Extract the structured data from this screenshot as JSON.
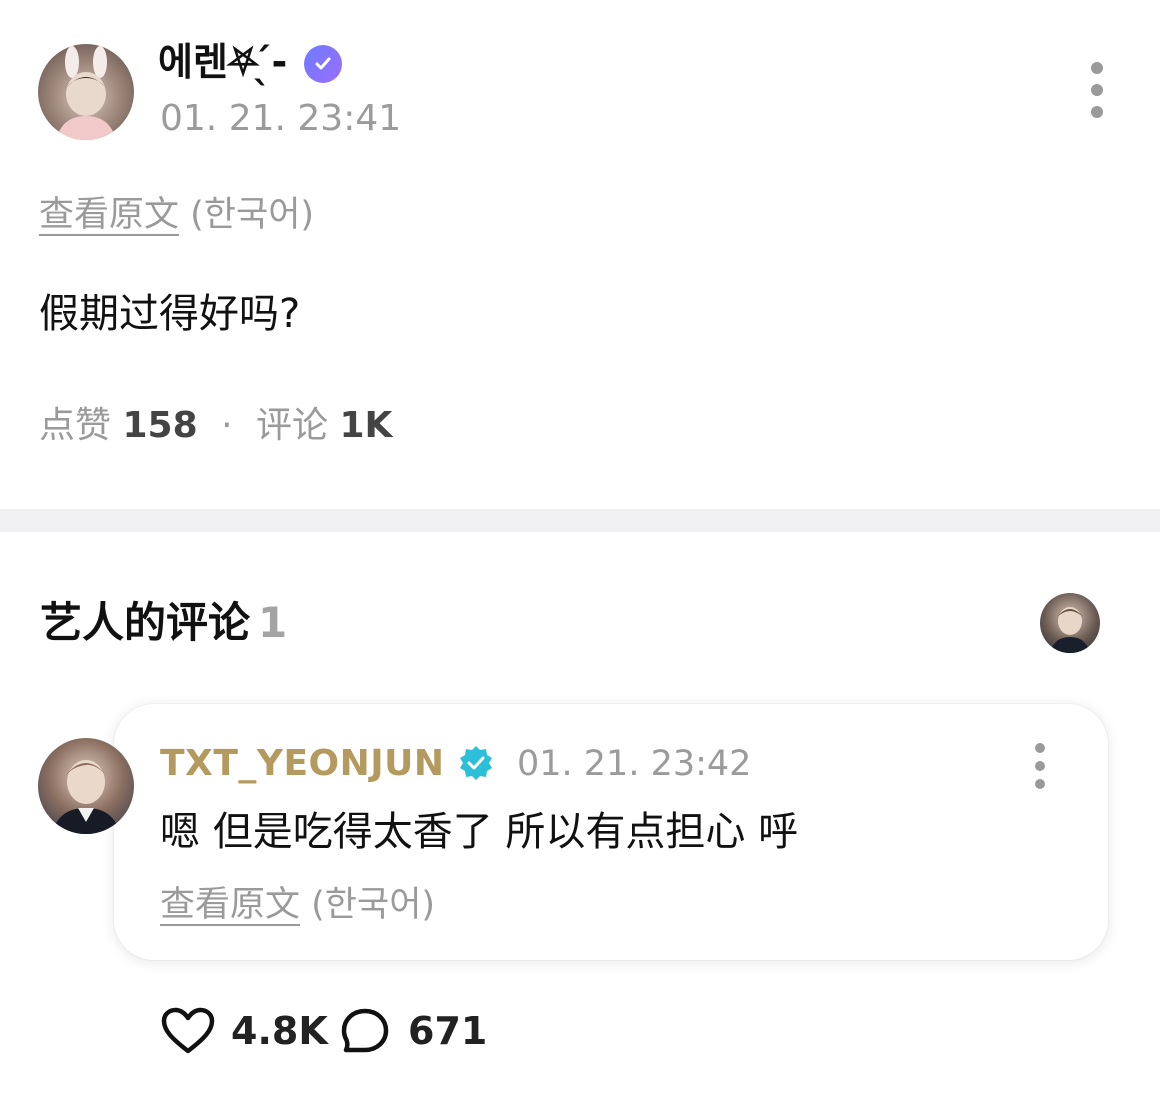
{
  "post": {
    "author_name": "에렌⛧ ̖́-",
    "verified_icon": "verified-heart-badge-icon",
    "time": "01. 21. 23:41",
    "more_icon": "more-vertical-icon",
    "translate_link": "查看原文",
    "translate_lang": "(한국어)",
    "body": "假期过得好吗?",
    "likes_label": "点赞",
    "likes_count": "158",
    "separator": "·",
    "comments_label": "评论",
    "comments_count": "1K"
  },
  "artist_comments": {
    "title": "艺人的评论",
    "count": "1",
    "comment": {
      "author_name": "TXT_YEONJUN",
      "verified_icon": "verified-check-badge-icon",
      "time": "01. 21. 23:42",
      "more_icon": "more-vertical-icon",
      "body": "嗯 但是吃得太香了 所以有点担心 呼",
      "translate_link": "查看原文",
      "translate_lang": "(한국어)",
      "like_icon": "heart-icon",
      "like_count": "4.8K",
      "reply_icon": "speech-bubble-icon",
      "reply_count": "671"
    }
  },
  "colors": {
    "artist_name": "#b49a5e",
    "artist_badge": "#2bbfd9",
    "muted_text": "#9a9a9a",
    "divider": "#f0f0f2"
  }
}
